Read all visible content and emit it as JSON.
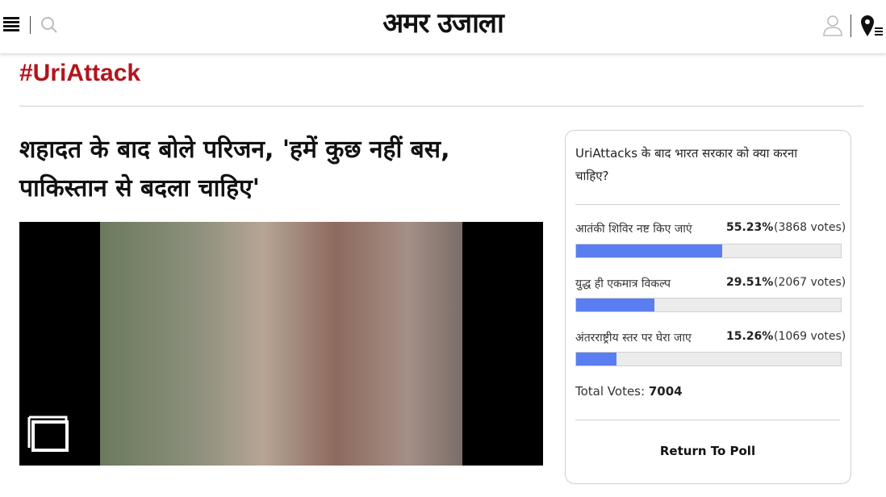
{
  "header": {
    "logo_text": "अमर उजाला",
    "icons": [
      "hamburger-menu-icon",
      "search-icon",
      "user-icon",
      "location-menu-icon"
    ]
  },
  "article": {
    "tag": "#UriAttack",
    "headline": "शहादत के बाद बोले परिजन, 'हमें कुछ नहीं बस, पाकिस्तान से बदला चाहिए'"
  },
  "poll": {
    "question": "UriAttacks के बाद भारत सरकार को क्या करना चाहिए?",
    "options": [
      {
        "label": "आतंकी शिविर नष्ट किए जाएं",
        "percent": "55.23%",
        "votes": "(3868 votes)",
        "fraction": 0.5523
      },
      {
        "label": "युद्ध ही एकमात्र विकल्प",
        "percent": "29.51%",
        "votes": "(2067 votes)",
        "fraction": 0.2951
      },
      {
        "label": "अंतरराष्ट्रीय स्तर पर घेरा जाए",
        "percent": "15.26%",
        "votes": "(1069 votes)",
        "fraction": 0.1526
      }
    ],
    "total_label": "Total Votes:",
    "total_value": "7004",
    "return_label": "Return To Poll",
    "bar_color": "#5a7df2"
  },
  "colors": {
    "accent": "#b3141d"
  }
}
